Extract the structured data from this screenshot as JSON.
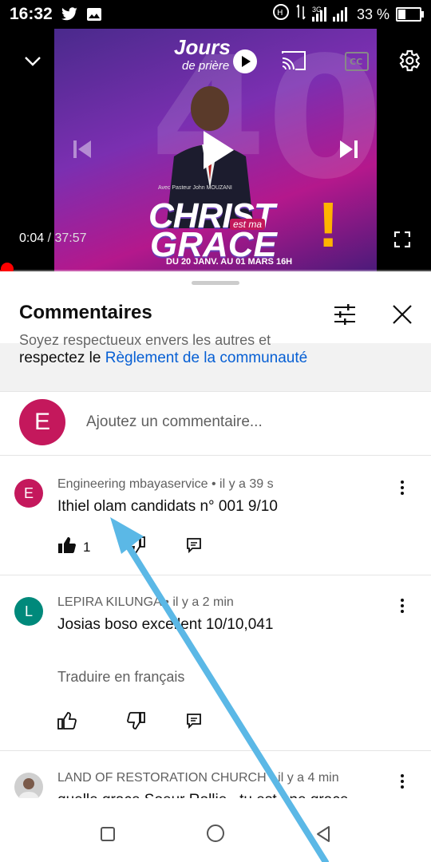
{
  "status_bar": {
    "time": "16:32",
    "network": "3G",
    "battery_text": "33 %",
    "battery_level": 0.33
  },
  "player": {
    "current_time": "0:04",
    "duration": "/ 37:57",
    "progress_fraction": 0.002,
    "thumbnail": {
      "jours": "Jours",
      "de_priere": "de prière",
      "number": "40",
      "christ": "CHRIST",
      "est_ma": "est ma",
      "grace": "GRACE",
      "exclaim": "!",
      "dates": "DU 20 JANV. AU 01 MARS  16H",
      "author": "Avec Pasteur John MOUZANI"
    }
  },
  "comments_sheet": {
    "title": "Commentaires",
    "guideline_clipped": "Soyez respectueux envers les autres et",
    "guideline_prefix": "respectez le ",
    "guideline_link": "Règlement de la communauté",
    "add_comment": {
      "avatar_letter": "E",
      "placeholder": "Ajoutez un commentaire..."
    },
    "comments": [
      {
        "avatar_letter": "E",
        "avatar_color": "#c4185c",
        "author": "Engineering mbayaservice",
        "age": " • il y a 39 s",
        "text": "Ithiel olam  candidats n° 001 9/10",
        "likes": "1"
      },
      {
        "avatar_letter": "L",
        "avatar_color": "#00897b",
        "author": "LEPIRA KILUNGA",
        "age": " • il y a 2 min",
        "text": "Josias boso excellent 10/10,041",
        "translate": "Traduire en français"
      },
      {
        "avatar_letter": "",
        "avatar_color": "#8d8d8d",
        "author": "LAND OF RESTORATION CHURCH",
        "age": " • il y a 4 min",
        "text": "quelle grace Soeur Rollie , tu est une grace"
      }
    ]
  },
  "colors": {
    "accent_red": "#ff0000",
    "link_blue": "#065fd4",
    "annotation_arrow": "#5bb8e6"
  }
}
